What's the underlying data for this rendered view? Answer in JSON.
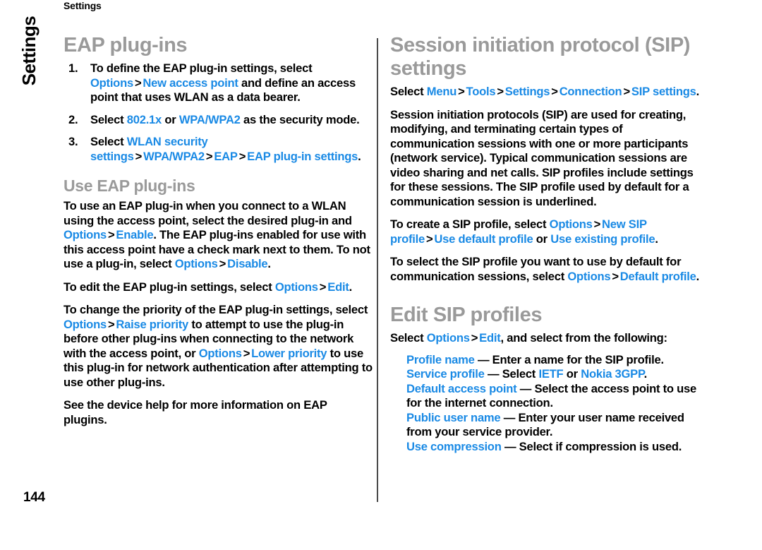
{
  "colors": {
    "ui_link": "#1a8ae5",
    "heading_gray": "#9a9a9a",
    "body_text": "#000000",
    "rule": "#4a4a4a"
  },
  "header": {
    "running_title": "Settings",
    "chapter_tab": "Settings"
  },
  "footer": {
    "page_number": "144"
  },
  "left_column": {
    "heading": "EAP plug-ins",
    "steps": [
      {
        "n": "1.",
        "parts": [
          {
            "t": "To define the EAP plug-in settings, select ",
            "k": "plain"
          },
          {
            "t": "Options",
            "k": "ui"
          },
          {
            "t": ">",
            "k": "gt"
          },
          {
            "t": "New access point",
            "k": "ui"
          },
          {
            "t": " and define an access point that uses WLAN as a data bearer.",
            "k": "plain"
          }
        ]
      },
      {
        "n": "2.",
        "parts": [
          {
            "t": "Select ",
            "k": "plain"
          },
          {
            "t": "802.1x",
            "k": "ui"
          },
          {
            "t": " or ",
            "k": "plain"
          },
          {
            "t": "WPA/WPA2",
            "k": "ui"
          },
          {
            "t": " as the security mode.",
            "k": "plain"
          }
        ]
      },
      {
        "n": "3.",
        "parts": [
          {
            "t": "Select ",
            "k": "plain"
          },
          {
            "t": "WLAN security settings",
            "k": "ui"
          },
          {
            "t": ">",
            "k": "gt"
          },
          {
            "t": "WPA/WPA2",
            "k": "ui"
          },
          {
            "t": ">",
            "k": "gt"
          },
          {
            "t": "EAP",
            "k": "ui"
          },
          {
            "t": ">",
            "k": "gt"
          },
          {
            "t": "EAP plug-in settings",
            "k": "ui"
          },
          {
            "t": ".",
            "k": "plain"
          }
        ]
      }
    ],
    "subheading": "Use EAP plug-ins",
    "paragraphs": [
      [
        {
          "t": "To use an EAP plug-in when you connect to a WLAN using the access point, select the desired plug-in and ",
          "k": "plain"
        },
        {
          "t": "Options",
          "k": "ui"
        },
        {
          "t": ">",
          "k": "gt"
        },
        {
          "t": "Enable",
          "k": "ui"
        },
        {
          "t": ". The EAP plug-ins enabled for use with this access point have a check mark next to them. To not use a plug-in, select ",
          "k": "plain"
        },
        {
          "t": "Options",
          "k": "ui"
        },
        {
          "t": ">",
          "k": "gt"
        },
        {
          "t": "Disable",
          "k": "ui"
        },
        {
          "t": ".",
          "k": "plain"
        }
      ],
      [
        {
          "t": "To edit the EAP plug-in settings, select ",
          "k": "plain"
        },
        {
          "t": "Options",
          "k": "ui"
        },
        {
          "t": ">",
          "k": "gt"
        },
        {
          "t": "Edit",
          "k": "ui"
        },
        {
          "t": ".",
          "k": "plain"
        }
      ],
      [
        {
          "t": "To change the priority of the EAP plug-in settings, select ",
          "k": "plain"
        },
        {
          "t": "Options",
          "k": "ui"
        },
        {
          "t": ">",
          "k": "gt"
        },
        {
          "t": "Raise priority",
          "k": "ui"
        },
        {
          "t": " to attempt to use the plug-in before other plug-ins when connecting to the network with the access point, or ",
          "k": "plain"
        },
        {
          "t": "Options",
          "k": "ui"
        },
        {
          "t": ">",
          "k": "gt"
        },
        {
          "t": "Lower priority",
          "k": "ui"
        },
        {
          "t": " to use this plug-in for network authentication after attempting to use other plug-ins.",
          "k": "plain"
        }
      ],
      [
        {
          "t": "See the device help for more information on EAP plugins.",
          "k": "plain"
        }
      ]
    ]
  },
  "right_column": {
    "heading": "Session initiation protocol (SIP) settings",
    "paragraphs": [
      [
        {
          "t": "Select ",
          "k": "plain"
        },
        {
          "t": "Menu",
          "k": "ui"
        },
        {
          "t": ">",
          "k": "gt"
        },
        {
          "t": "Tools",
          "k": "ui"
        },
        {
          "t": ">",
          "k": "gt"
        },
        {
          "t": "Settings",
          "k": "ui"
        },
        {
          "t": ">",
          "k": "gt"
        },
        {
          "t": "Connection",
          "k": "ui"
        },
        {
          "t": ">",
          "k": "gt"
        },
        {
          "t": "SIP settings",
          "k": "ui"
        },
        {
          "t": ".",
          "k": "plain"
        }
      ],
      [
        {
          "t": "Session initiation protocols (SIP) are used for creating, modifying, and terminating certain types of communication sessions with one or more participants (network service). Typical communication sessions are video sharing and net calls. SIP profiles include settings for these sessions. The SIP profile used by default for a communication session is underlined.",
          "k": "plain"
        }
      ],
      [
        {
          "t": "To create a SIP profile, select ",
          "k": "plain"
        },
        {
          "t": "Options",
          "k": "ui"
        },
        {
          "t": ">",
          "k": "gt"
        },
        {
          "t": "New SIP profile",
          "k": "ui"
        },
        {
          "t": ">",
          "k": "gt"
        },
        {
          "t": "Use default profile",
          "k": "ui"
        },
        {
          "t": " or ",
          "k": "plain"
        },
        {
          "t": "Use existing profile",
          "k": "ui"
        },
        {
          "t": ".",
          "k": "plain"
        }
      ],
      [
        {
          "t": "To select the SIP profile you want to use by default for communication sessions, select ",
          "k": "plain"
        },
        {
          "t": "Options",
          "k": "ui"
        },
        {
          "t": ">",
          "k": "gt"
        },
        {
          "t": "Default profile",
          "k": "ui"
        },
        {
          "t": ".",
          "k": "plain"
        }
      ]
    ],
    "heading2": "Edit SIP profiles",
    "intro": [
      {
        "t": "Select ",
        "k": "plain"
      },
      {
        "t": "Options",
        "k": "ui"
      },
      {
        "t": ">",
        "k": "gt"
      },
      {
        "t": "Edit",
        "k": "ui"
      },
      {
        "t": ", and select from the following:",
        "k": "plain"
      }
    ],
    "definitions": [
      [
        {
          "t": "Profile name",
          "k": "ui"
        },
        {
          "t": " — Enter a name for the SIP profile.",
          "k": "plain"
        }
      ],
      [
        {
          "t": "Service profile",
          "k": "ui"
        },
        {
          "t": " — Select ",
          "k": "plain"
        },
        {
          "t": "IETF",
          "k": "ui"
        },
        {
          "t": " or ",
          "k": "plain"
        },
        {
          "t": "Nokia 3GPP",
          "k": "ui"
        },
        {
          "t": ".",
          "k": "plain"
        }
      ],
      [
        {
          "t": "Default access point",
          "k": "ui"
        },
        {
          "t": " — Select the access point to use for the internet connection.",
          "k": "plain"
        }
      ],
      [
        {
          "t": "Public user name",
          "k": "ui"
        },
        {
          "t": " — Enter your user name received from your service provider.",
          "k": "plain"
        }
      ],
      [
        {
          "t": "Use compression",
          "k": "ui"
        },
        {
          "t": " — Select if compression is used.",
          "k": "plain"
        }
      ]
    ]
  }
}
